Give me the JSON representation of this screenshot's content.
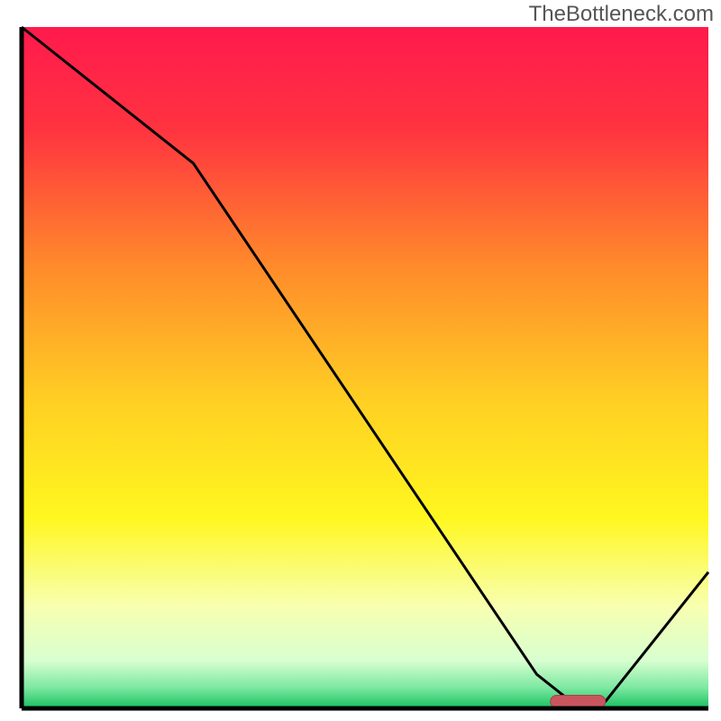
{
  "watermark": "TheBottleneck.com",
  "chart_data": {
    "type": "line",
    "title": "",
    "xlabel": "",
    "ylabel": "",
    "xlim": [
      0,
      100
    ],
    "ylim": [
      0,
      100
    ],
    "x": [
      0,
      25,
      75,
      80,
      85,
      100
    ],
    "values": [
      100,
      80,
      5,
      1,
      1,
      20
    ],
    "marker": {
      "x_start": 77,
      "x_end": 85,
      "y": 1
    },
    "gradient_stops": [
      {
        "offset": 0.0,
        "color": "#ff1a4d"
      },
      {
        "offset": 0.15,
        "color": "#ff3340"
      },
      {
        "offset": 0.35,
        "color": "#ff8a2b"
      },
      {
        "offset": 0.55,
        "color": "#ffd023"
      },
      {
        "offset": 0.72,
        "color": "#fff71f"
      },
      {
        "offset": 0.85,
        "color": "#f8ffb0"
      },
      {
        "offset": 0.93,
        "color": "#d8ffd0"
      },
      {
        "offset": 0.97,
        "color": "#7be8a0"
      },
      {
        "offset": 1.0,
        "color": "#18c060"
      }
    ],
    "axis_color": "#000000",
    "line_color": "#000000",
    "marker_fill": "#c9565e",
    "marker_stroke": "#a83f47"
  }
}
